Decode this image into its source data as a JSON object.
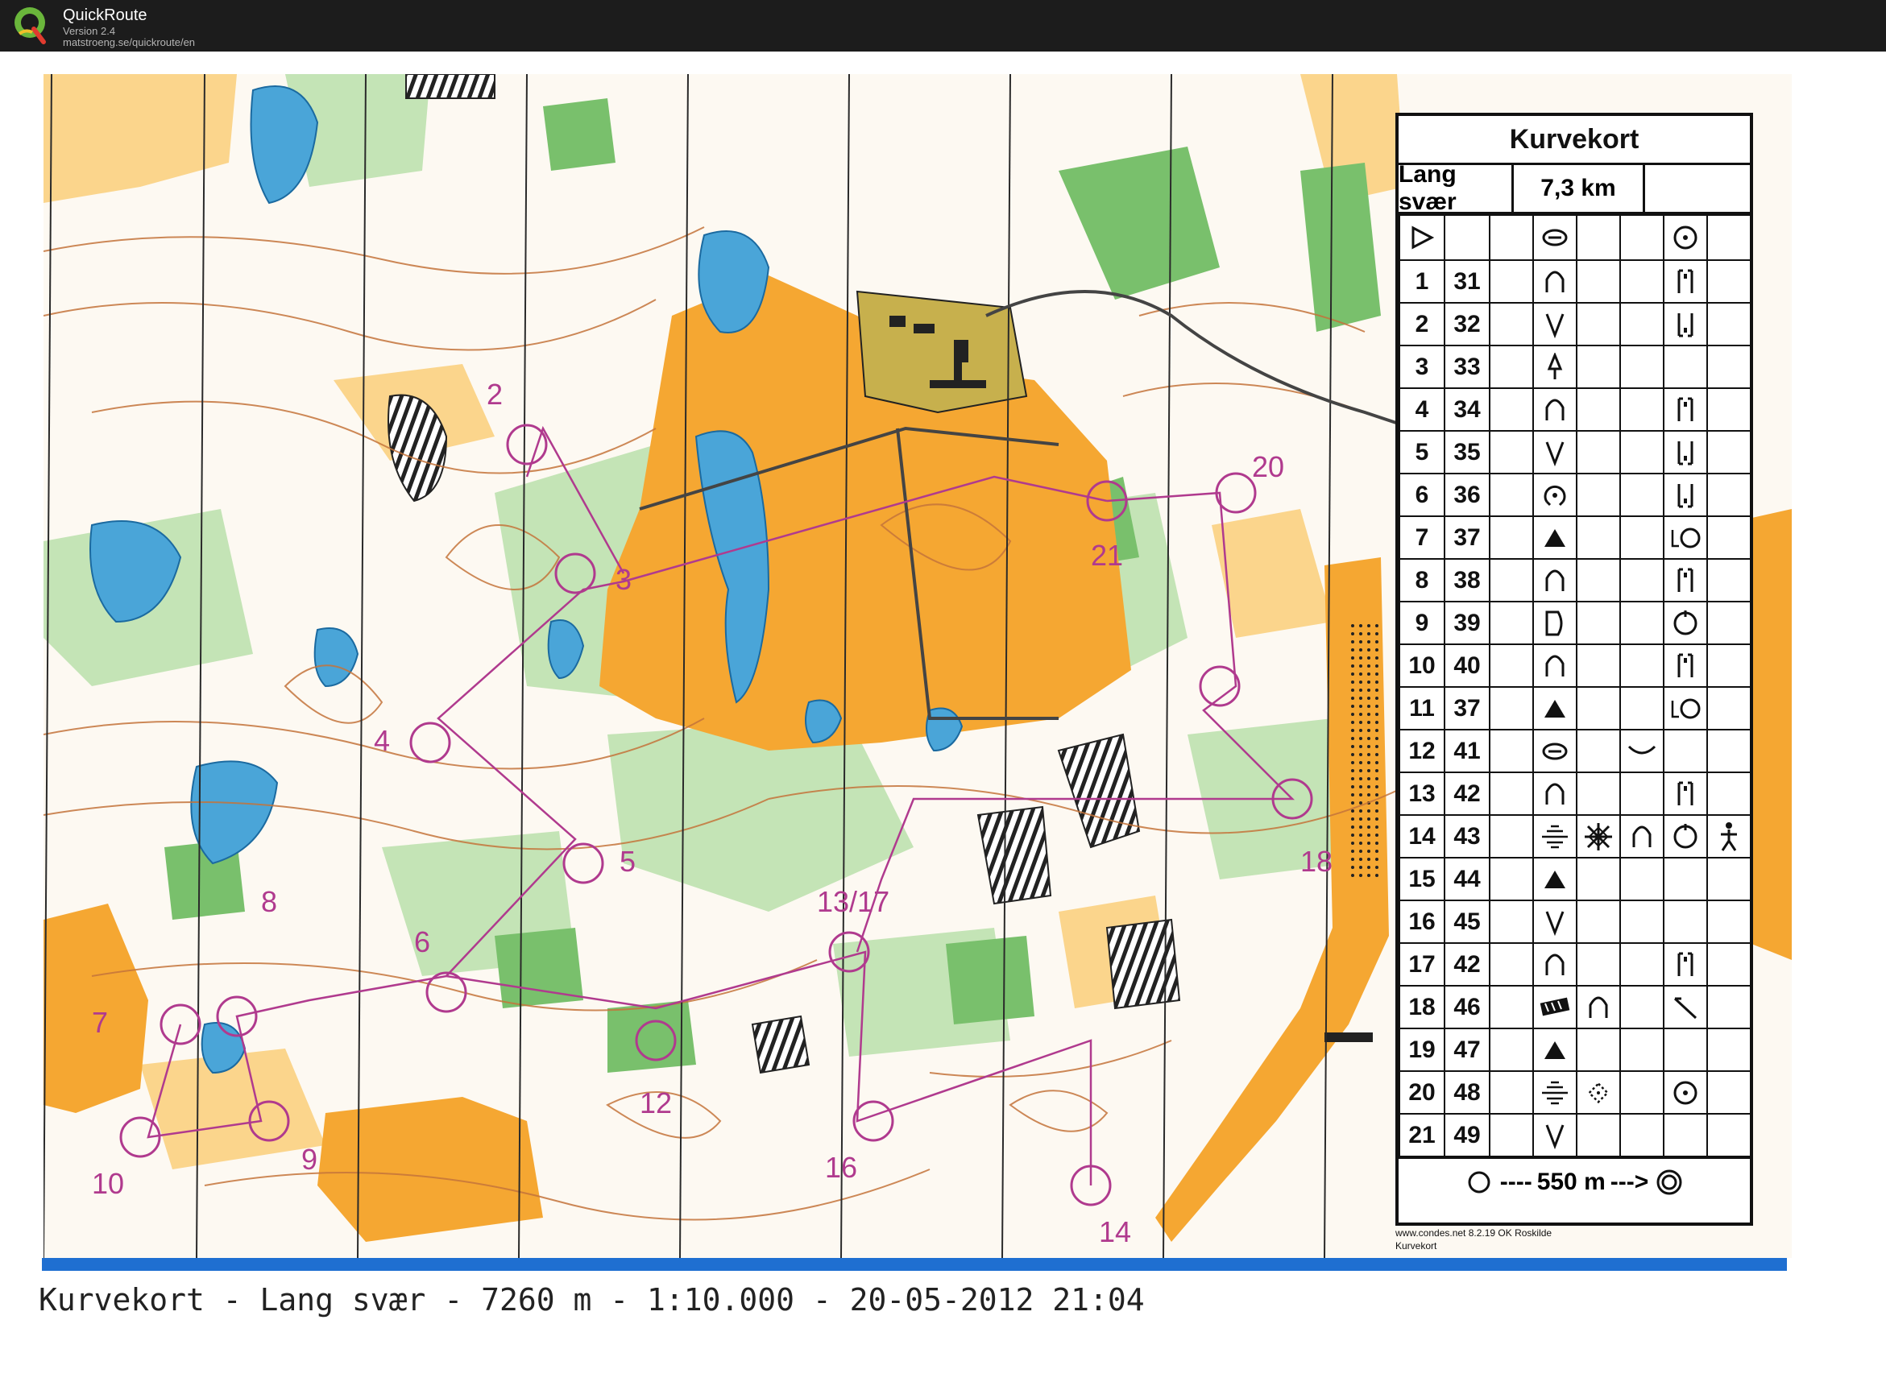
{
  "app": {
    "name": "QuickRoute",
    "version": "Version 2.4",
    "url": "matstroeng.se/quickroute/en"
  },
  "map": {
    "control_numbers": [
      "2",
      "3",
      "4",
      "5",
      "6",
      "7",
      "8",
      "9",
      "10",
      "12",
      "13/17",
      "14",
      "16",
      "18",
      "20",
      "21"
    ],
    "colors": {
      "open": "#f5a732",
      "rough_open": "#fbd58c",
      "forest_green": "#79c06c",
      "light_green": "#c4e4b6",
      "water": "#4aa5d8",
      "contour": "#c4743b",
      "course": "#b03a8e"
    }
  },
  "description_sheet": {
    "title": "Kurvekort",
    "course_name": "Lang svær",
    "course_length": "7,3 km",
    "controls": [
      {
        "num": "1",
        "code": "31",
        "feature": "knoll-icon",
        "dim": "",
        "extra": "",
        "where": "between-icon",
        "other": ""
      },
      {
        "num": "2",
        "code": "32",
        "feature": "depression-icon",
        "dim": "",
        "extra": "",
        "where": "between-low-icon",
        "other": ""
      },
      {
        "num": "3",
        "code": "33",
        "feature": "rootstock-icon",
        "dim": "",
        "extra": "",
        "where": "",
        "other": ""
      },
      {
        "num": "4",
        "code": "34",
        "feature": "knoll-icon",
        "dim": "",
        "extra": "",
        "where": "between-icon",
        "other": ""
      },
      {
        "num": "5",
        "code": "35",
        "feature": "depression-icon",
        "dim": "",
        "extra": "",
        "where": "between-low-icon",
        "other": ""
      },
      {
        "num": "6",
        "code": "36",
        "feature": "pit-icon",
        "dim": "",
        "extra": "",
        "where": "between-low-icon",
        "other": ""
      },
      {
        "num": "7",
        "code": "37",
        "feature": "boulder-icon",
        "dim": "",
        "extra": "",
        "where": "lower-part-icon",
        "other": ""
      },
      {
        "num": "8",
        "code": "38",
        "feature": "knoll-icon",
        "dim": "",
        "extra": "",
        "where": "between-icon",
        "other": ""
      },
      {
        "num": "9",
        "code": "39",
        "feature": "cliff-icon",
        "dim": "",
        "extra": "",
        "where": "foot-icon",
        "other": ""
      },
      {
        "num": "10",
        "code": "40",
        "feature": "knoll-icon",
        "dim": "",
        "extra": "",
        "where": "between-icon",
        "other": ""
      },
      {
        "num": "11",
        "code": "37",
        "feature": "boulder-icon",
        "dim": "",
        "extra": "",
        "where": "lower-part-icon",
        "other": ""
      },
      {
        "num": "12",
        "code": "41",
        "feature": "elongated-knoll-icon",
        "dim": "",
        "extra": "bend-icon",
        "where": "",
        "other": ""
      },
      {
        "num": "13",
        "code": "42",
        "feature": "knoll-icon",
        "dim": "",
        "extra": "",
        "where": "between-icon",
        "other": ""
      },
      {
        "num": "14",
        "code": "43",
        "feature": "marsh-icon",
        "dim": "thicket-icon",
        "extra": "knoll-icon",
        "where": "foot-icon",
        "other": "person-icon"
      },
      {
        "num": "15",
        "code": "44",
        "feature": "boulder-icon",
        "dim": "",
        "extra": "",
        "where": "",
        "other": ""
      },
      {
        "num": "16",
        "code": "45",
        "feature": "depression-icon",
        "dim": "",
        "extra": "",
        "where": "",
        "other": ""
      },
      {
        "num": "17",
        "code": "42",
        "feature": "knoll-icon",
        "dim": "",
        "extra": "",
        "where": "between-icon",
        "other": ""
      },
      {
        "num": "18",
        "code": "46",
        "feature": "rock-terrain-icon",
        "dim": "knoll-icon",
        "extra": "",
        "where": "corner-icon",
        "other": ""
      },
      {
        "num": "19",
        "code": "47",
        "feature": "boulder-icon",
        "dim": "",
        "extra": "",
        "where": "",
        "other": ""
      },
      {
        "num": "20",
        "code": "48",
        "feature": "marsh-icon",
        "dim": "thicket-small-icon",
        "extra": "",
        "where": "control-circle-icon",
        "other": ""
      },
      {
        "num": "21",
        "code": "49",
        "feature": "depression-icon",
        "dim": "",
        "extra": "",
        "where": "",
        "other": ""
      }
    ],
    "finish": "550 m",
    "footer_line1": "www.condes.net 8.2.19 OK Roskilde",
    "footer_line2": "Kurvekort"
  },
  "caption": "Kurvekort - Lang svær - 7260 m - 1:10.000 - 20-05-2012 21:04"
}
